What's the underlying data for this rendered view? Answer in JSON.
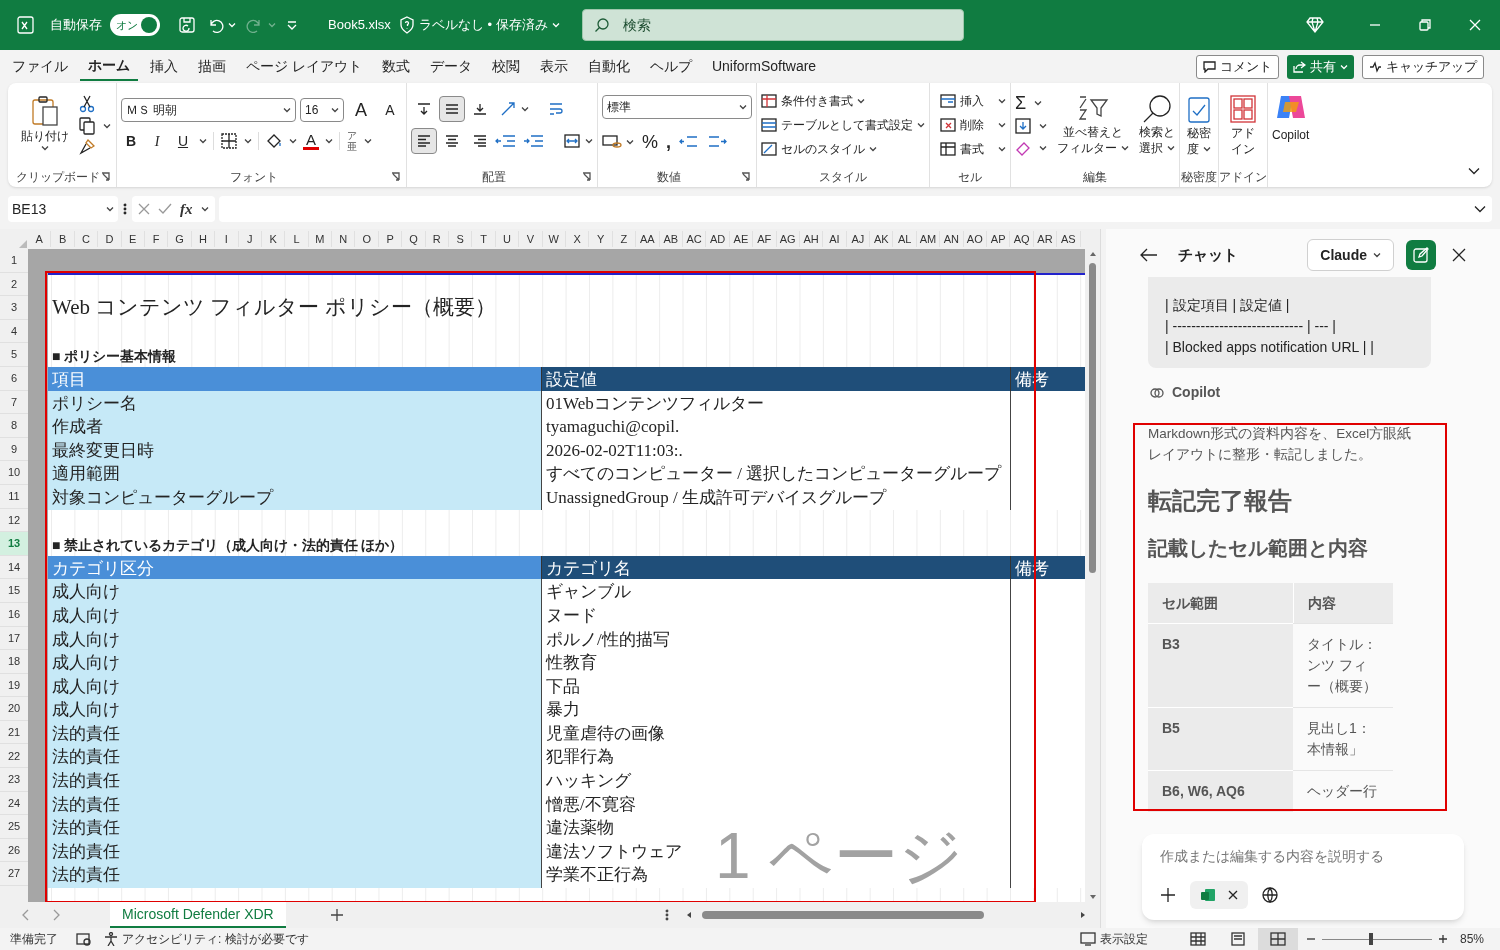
{
  "title_bar": {
    "autosave_label": "自動保存",
    "autosave_on": true,
    "autosave_state": "オン",
    "filename": "Book5.xlsx",
    "label_status": "ラベルなし • 保存済み",
    "search_placeholder": "検索"
  },
  "menu_tabs": [
    {
      "label": "ファイル",
      "selected": false
    },
    {
      "label": "ホーム",
      "selected": true
    },
    {
      "label": "挿入",
      "selected": false
    },
    {
      "label": "描画",
      "selected": false
    },
    {
      "label": "ページ レイアウト",
      "selected": false
    },
    {
      "label": "数式",
      "selected": false
    },
    {
      "label": "データ",
      "selected": false
    },
    {
      "label": "校閲",
      "selected": false
    },
    {
      "label": "表示",
      "selected": false
    },
    {
      "label": "自動化",
      "selected": false
    },
    {
      "label": "ヘルプ",
      "selected": false
    },
    {
      "label": "UniformSoftware",
      "selected": false
    }
  ],
  "header_buttons": {
    "comment": "コメント",
    "share": "共有",
    "catch_up": "キャッチアップ"
  },
  "ribbon": {
    "clipboard": {
      "paste": "貼り付け",
      "label": "クリップボード"
    },
    "font": {
      "name": "ＭＳ 明朝",
      "size": "16",
      "grow": "A",
      "shrink": "A",
      "bold": "B",
      "italic": "I",
      "underline": "U",
      "font_color": "A",
      "phonetic": "ア亜",
      "label": "フォント"
    },
    "alignment": {
      "vertical": [
        {
          "selected": false
        },
        {
          "selected": true
        },
        {
          "selected": false
        }
      ],
      "horizontal": [
        {
          "selected": true
        },
        {
          "selected": false
        },
        {
          "selected": false
        }
      ],
      "label": "配置"
    },
    "number": {
      "format": "標準",
      "percent": "%",
      "comma": ",",
      "label": "数値"
    },
    "styles": {
      "items": [
        "条件付き書式",
        "テーブルとして書式設定",
        "セルのスタイル"
      ],
      "label": "スタイル"
    },
    "cells": {
      "items": [
        "挿入",
        "削除",
        "書式"
      ],
      "label": "セル"
    },
    "editing": {
      "sum": "Σ",
      "sort_lines": [
        "並べ替えと",
        "フィルター"
      ],
      "find_lines": [
        "検索と",
        "選択"
      ],
      "label": "編集"
    },
    "sensitivity": {
      "lines": [
        "秘密",
        "度"
      ],
      "label": "秘密度"
    },
    "addins": {
      "lines": [
        "アド",
        "イン"
      ],
      "label": "アドイン"
    },
    "copilot": {
      "label": "Copilot"
    }
  },
  "formula_bar": {
    "name_box": "BE13",
    "fx": "fx"
  },
  "columns": [
    "A",
    "B",
    "C",
    "D",
    "E",
    "F",
    "G",
    "H",
    "I",
    "J",
    "K",
    "L",
    "M",
    "N",
    "O",
    "P",
    "Q",
    "R",
    "S",
    "T",
    "U",
    "V",
    "W",
    "X",
    "Y",
    "Z",
    "AA",
    "AB",
    "AC",
    "AD",
    "AE",
    "AF",
    "AG",
    "AH",
    "AI",
    "AJ",
    "AK",
    "AL",
    "AM",
    "AN",
    "AO",
    "AP",
    "AQ",
    "AR",
    "AS"
  ],
  "row_headers": [
    {
      "label": "1",
      "selected": false
    },
    {
      "label": "2",
      "selected": false
    },
    {
      "label": "3",
      "selected": false
    },
    {
      "label": "4",
      "selected": false
    },
    {
      "label": "5",
      "selected": false
    },
    {
      "label": "6",
      "selected": false
    },
    {
      "label": "7",
      "selected": false
    },
    {
      "label": "8",
      "selected": false
    },
    {
      "label": "9",
      "selected": false
    },
    {
      "label": "10",
      "selected": false
    },
    {
      "label": "11",
      "selected": false
    },
    {
      "label": "12",
      "selected": false
    },
    {
      "label": "13",
      "selected": true
    },
    {
      "label": "14",
      "selected": false
    },
    {
      "label": "15",
      "selected": false
    },
    {
      "label": "16",
      "selected": false
    },
    {
      "label": "17",
      "selected": false
    },
    {
      "label": "18",
      "selected": false
    },
    {
      "label": "19",
      "selected": false
    },
    {
      "label": "20",
      "selected": false
    },
    {
      "label": "21",
      "selected": false
    },
    {
      "label": "22",
      "selected": false
    },
    {
      "label": "23",
      "selected": false
    },
    {
      "label": "24",
      "selected": false
    },
    {
      "label": "25",
      "selected": false
    },
    {
      "label": "26",
      "selected": false
    },
    {
      "label": "27",
      "selected": false
    }
  ],
  "sheet": {
    "title": "Web コンテンツ フィルター ポリシー（概要）",
    "page_label": "1 ページ",
    "sections": [
      {
        "heading": "■ ポリシー基本情報",
        "header": [
          "項目",
          "設定値",
          "備考"
        ],
        "rows": [
          [
            "ポリシー名",
            "01Webコンテンツフィルター"
          ],
          [
            "作成者",
            "tyamaguchi@copil."
          ],
          [
            "最終変更日時",
            "2026-02-02T11:03:."
          ],
          [
            "適用範囲",
            "すべてのコンピューター / 選択したコンピューターグループ"
          ],
          [
            "対象コンピューターグループ",
            "UnassignedGroup / 生成許可デバイスグループ"
          ]
        ]
      },
      {
        "heading": "■ 禁止されているカテゴリ（成人向け・法的責任 ほか）",
        "header": [
          "カテゴリ区分",
          "カテゴリ名",
          "備考"
        ],
        "rows": [
          [
            "成人向け",
            "ギャンブル"
          ],
          [
            "成人向け",
            "ヌード"
          ],
          [
            "成人向け",
            "ポルノ/性的描写"
          ],
          [
            "成人向け",
            "性教育"
          ],
          [
            "成人向け",
            "下品"
          ],
          [
            "成人向け",
            "暴力"
          ],
          [
            "法的責任",
            "児童虐待の画像"
          ],
          [
            "法的責任",
            "犯罪行為"
          ],
          [
            "法的責任",
            "ハッキング"
          ],
          [
            "法的責任",
            "憎悪/不寛容"
          ],
          [
            "法的責任",
            "違法薬物"
          ],
          [
            "法的責任",
            "違法ソフトウェア"
          ],
          [
            "法的責任",
            "学業不正行為"
          ]
        ]
      }
    ]
  },
  "sheet_tabs": [
    {
      "label": "Microsoft Defender XDR",
      "selected": true
    }
  ],
  "chat": {
    "title": "チャット",
    "model": "Claude",
    "user_message_lines": [
      "| 設定項目 | 設定値 |",
      "| ---------------------------- | --- |",
      "| Blocked apps notification URL | |"
    ],
    "assistant_name": "Copilot",
    "response_text": "Markdown形式の資料内容を、Excel方眼紙レイアウトに整形・転記しました。",
    "heading1": "転記完了報告",
    "heading2": "記載したセル範囲と内容",
    "table_columns": [
      "セル範囲",
      "内容"
    ],
    "table_rows": [
      {
        "range": "B3",
        "content_lines": [
          "タイトル：",
          "ンツ フィ",
          "ー（概要）"
        ]
      },
      {
        "range": "B5",
        "content_lines": [
          "見出し1：",
          "本情報」"
        ]
      },
      {
        "range": "B6, W6, AQ6",
        "content_lines": [
          "ヘッダー行"
        ]
      }
    ],
    "input_placeholder": "作成または編集する内容を説明する"
  },
  "status_bar": {
    "ready": "準備完了",
    "accessibility": "アクセシビリティ: 検討が必要です",
    "display_settings": "表示設定",
    "views": [
      {
        "selected": false
      },
      {
        "selected": false
      },
      {
        "selected": true
      }
    ],
    "zoom_slider": {
      "level": 0.43
    },
    "zoom": "85%"
  }
}
